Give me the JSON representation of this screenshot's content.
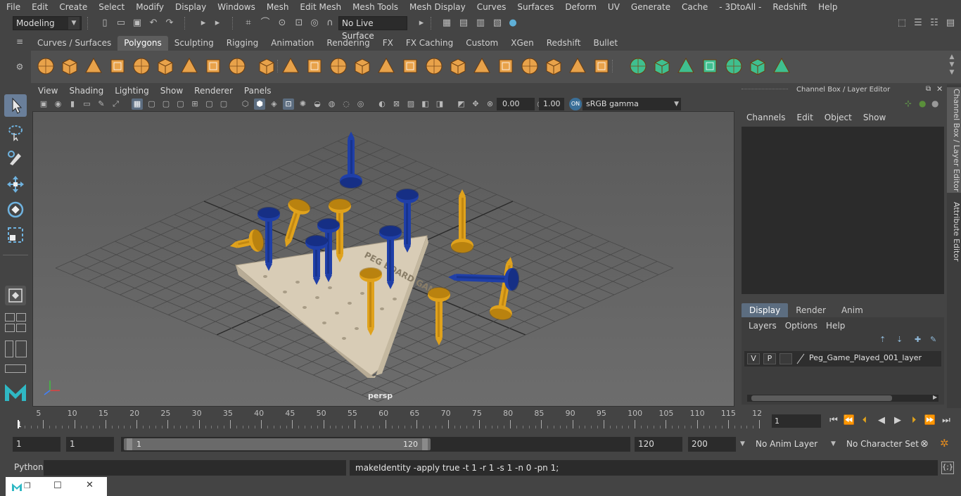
{
  "menu": [
    "File",
    "Edit",
    "Create",
    "Select",
    "Modify",
    "Display",
    "Windows",
    "Mesh",
    "Edit Mesh",
    "Mesh Tools",
    "Mesh Display",
    "Curves",
    "Surfaces",
    "Deform",
    "UV",
    "Generate",
    "Cache",
    "- 3DtoAll -",
    "Redshift",
    "Help"
  ],
  "status": {
    "mode": "Modeling",
    "live_surface": "No Live Surface"
  },
  "shelf_tabs": [
    "Curves / Surfaces",
    "Polygons",
    "Sculpting",
    "Rigging",
    "Animation",
    "Rendering",
    "FX",
    "FX Caching",
    "Custom",
    "XGen",
    "Redshift",
    "Bullet"
  ],
  "viewport": {
    "menu": [
      "View",
      "Shading",
      "Lighting",
      "Show",
      "Renderer",
      "Panels"
    ],
    "exposure": "0.00",
    "gamma": "1.00",
    "color_space": "sRGB gamma",
    "camera_label": "persp",
    "board_text": "PEG BOARD GAME"
  },
  "channel_box": {
    "title": "Channel Box / Layer Editor",
    "menu": [
      "Channels",
      "Edit",
      "Object",
      "Show"
    ]
  },
  "layer_editor": {
    "tabs": [
      "Display",
      "Render",
      "Anim"
    ],
    "menu": [
      "Layers",
      "Options",
      "Help"
    ],
    "layer": {
      "v": "V",
      "p": "P",
      "name": "Peg_Game_Played_001_layer"
    }
  },
  "side_tabs": [
    "Channel Box / Layer Editor",
    "Attribute Editor"
  ],
  "timeline": {
    "ticks": [
      "5",
      "10",
      "15",
      "20",
      "25",
      "30",
      "35",
      "40",
      "45",
      "50",
      "55",
      "60",
      "65",
      "70",
      "75",
      "80",
      "85",
      "90",
      "95",
      "100",
      "105",
      "110",
      "115",
      "12"
    ],
    "start_marker": "1",
    "current_frame": "1"
  },
  "range": {
    "start": "1",
    "playback_start": "1",
    "slider_start": "1",
    "slider_end": "120",
    "playback_end": "120",
    "end": "200",
    "anim_layer": "No Anim Layer",
    "character_set": "No Character Set"
  },
  "command_line": {
    "language": "Python",
    "output": "makeIdentity -apply true -t 1 -r 1 -s 1 -n 0 -pn 1;"
  },
  "colors": {
    "accent": "#5c6d80",
    "peg_blue": "#1f3fa8",
    "peg_yellow": "#e0a21c",
    "board": "#d8ccb6"
  }
}
